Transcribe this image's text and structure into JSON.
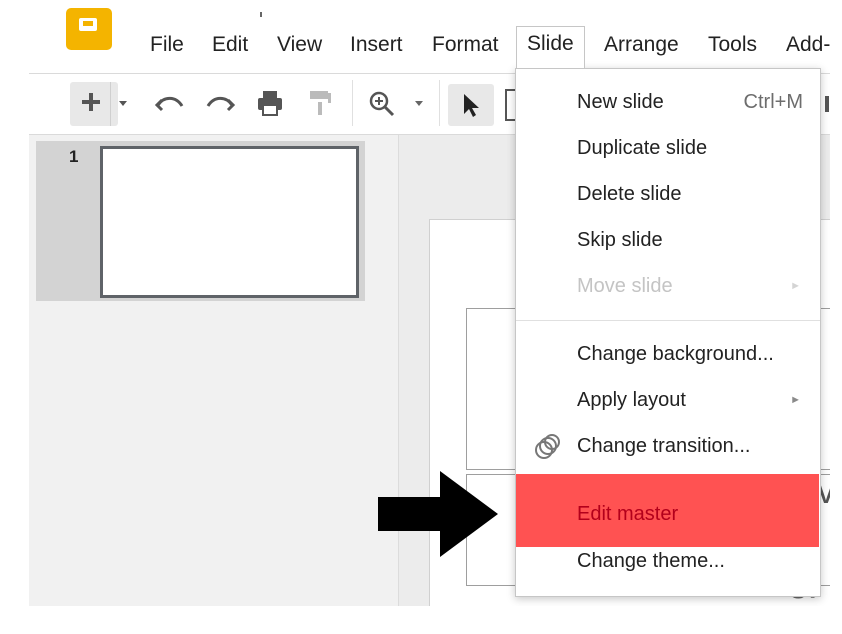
{
  "app": {
    "menus": [
      "File",
      "Edit",
      "View",
      "Insert",
      "Format",
      "Slide",
      "Arrange",
      "Tools",
      "Add-"
    ],
    "active_menu": "Slide"
  },
  "toolbar": {
    "icons": [
      "add-icon",
      "undo-icon",
      "redo-icon",
      "print-icon",
      "paint-format-icon",
      "zoom-icon",
      "select-cursor-icon",
      "textbox-icon"
    ]
  },
  "filmstrip": {
    "slide_number": "1"
  },
  "slide_menu": {
    "items": [
      {
        "label": "New slide",
        "shortcut": "Ctrl+M"
      },
      {
        "label": "Duplicate slide"
      },
      {
        "label": "Delete slide"
      },
      {
        "label": "Skip slide"
      },
      {
        "label": "Move slide",
        "disabled": true,
        "submenu": "►"
      },
      {
        "label": "Change background..."
      },
      {
        "label": "Apply layout",
        "submenu": "►"
      },
      {
        "label": "Change transition...",
        "icon": "transition-icon"
      },
      {
        "label": "Edit master",
        "highlighted": true
      },
      {
        "label": "Change theme..."
      }
    ]
  },
  "canvas": {
    "partial_text": "cl",
    "edge_text": "v"
  },
  "colors": {
    "highlight_bg": "#ff5252",
    "highlight_text": "#b3001b",
    "logo_yellow": "#f4b400",
    "annotation_arrow": "#000000"
  }
}
